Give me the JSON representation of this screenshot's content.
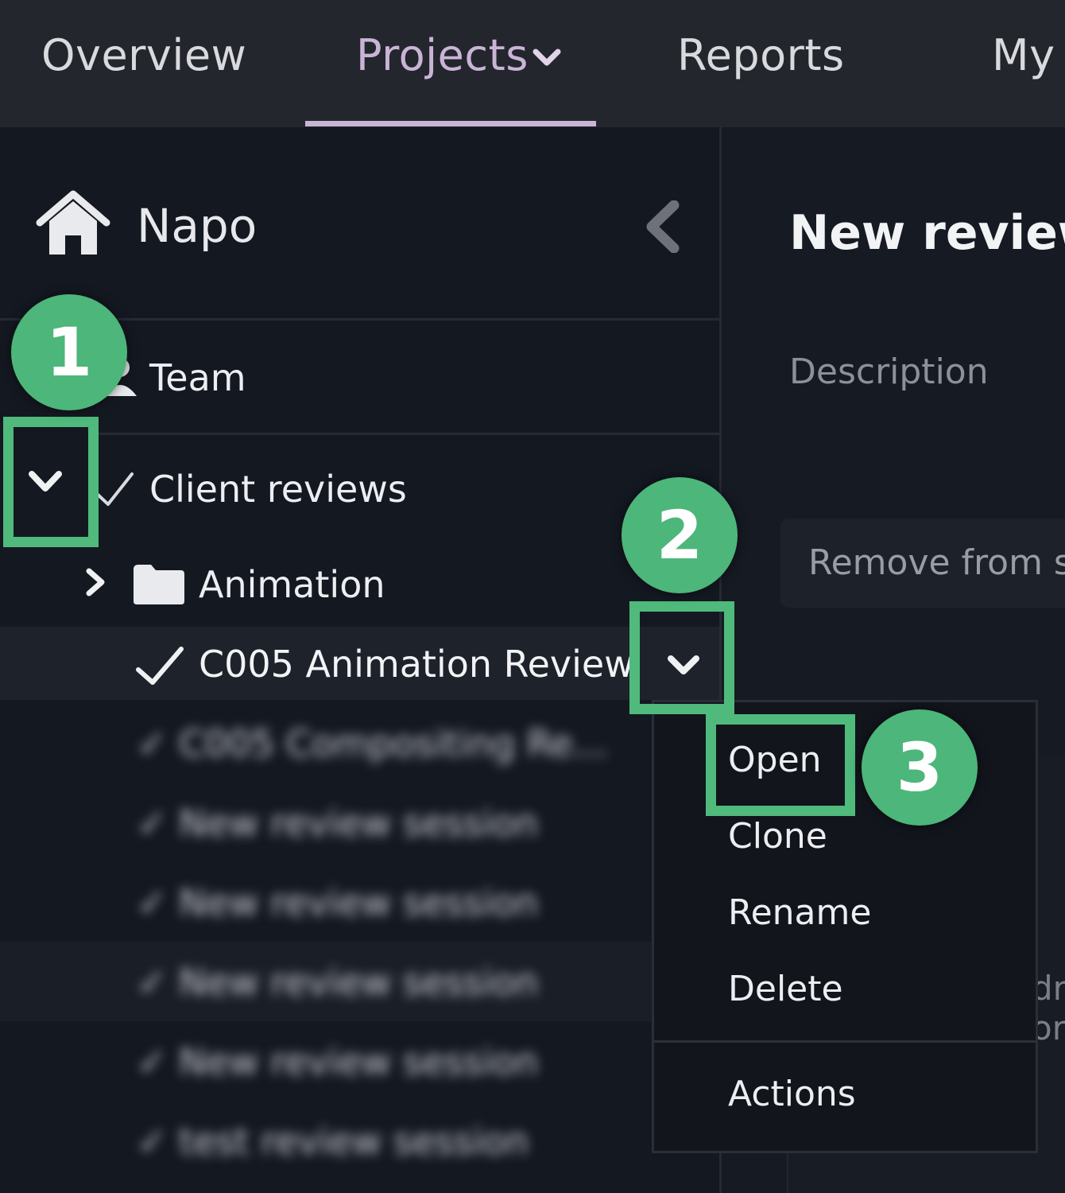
{
  "nav": {
    "items": [
      {
        "label": "Overview"
      },
      {
        "label": "Projects",
        "active": true
      },
      {
        "label": "Reports"
      },
      {
        "label": "My T"
      }
    ]
  },
  "sidebar": {
    "root": {
      "label": "Napo",
      "icon": "home-icon"
    },
    "team": {
      "label": "Team",
      "icon": "user-icon"
    },
    "client_reviews": {
      "label": "Client reviews",
      "icon": "check-icon"
    },
    "animation_folder": {
      "label": "Animation",
      "icon": "folder-icon"
    },
    "selected_session": {
      "label": "C005 Animation Review",
      "icon": "check-icon"
    },
    "blurred_sessions": [
      {
        "label": "C005 Compositing Re..."
      },
      {
        "label": "New review session"
      },
      {
        "label": "New review session"
      },
      {
        "label": "New review session"
      },
      {
        "label": "New review session"
      },
      {
        "label": "test review session"
      }
    ]
  },
  "main": {
    "title": "New review",
    "description_label": "Description",
    "remove_button": "Remove from s",
    "partial_texts": [
      "dr",
      "or"
    ]
  },
  "context_menu": {
    "items": [
      "Open",
      "Clone",
      "Rename",
      "Delete"
    ],
    "footer_item": "Actions"
  },
  "annotations": {
    "step1": "1",
    "step2": "2",
    "step3": "3",
    "color": "#4db67a"
  },
  "colors": {
    "accent": "#c9b4d6",
    "background": "#141821",
    "nav_background": "#23262d"
  }
}
